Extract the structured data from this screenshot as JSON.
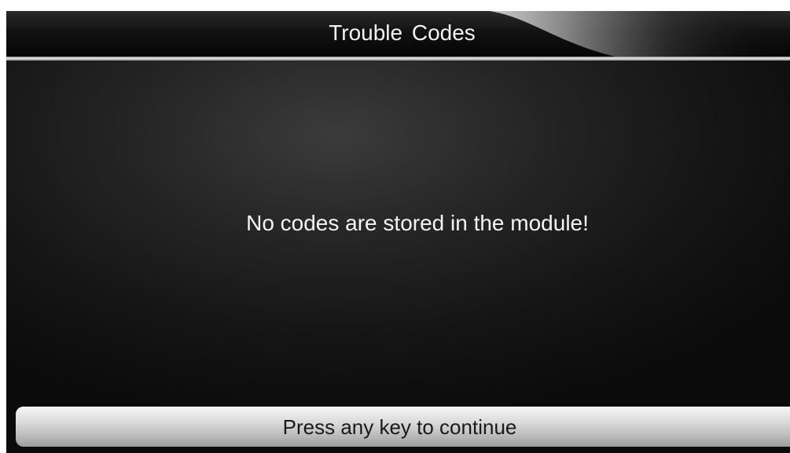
{
  "header": {
    "title": "Trouble  Codes"
  },
  "main": {
    "message": "No codes are stored in the module!"
  },
  "footer": {
    "prompt": "Press any key to continue"
  },
  "colors": {
    "background": "#1c1c1c",
    "text": "#f4f4f4",
    "footer_bar": "#d0d0d0",
    "footer_text": "#1a1a1a"
  }
}
